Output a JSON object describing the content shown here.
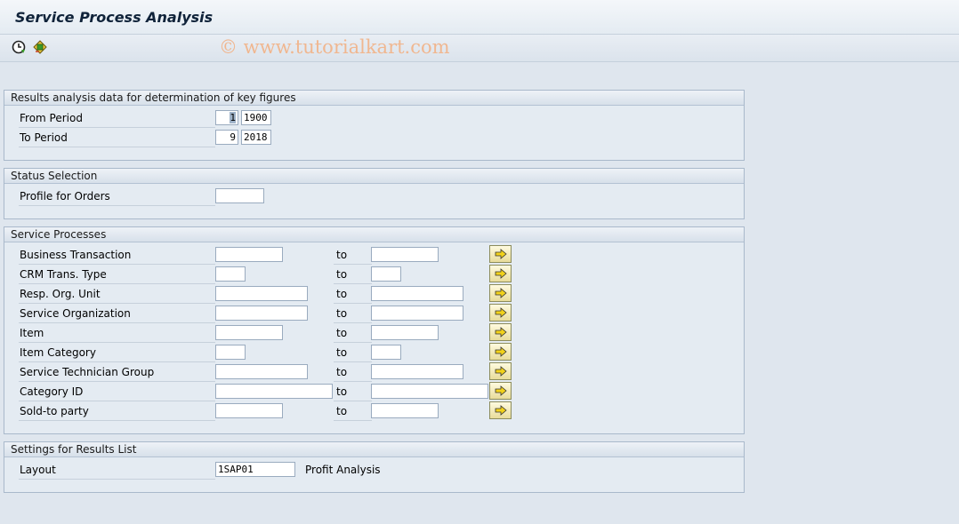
{
  "window": {
    "title": "Service Process Analysis"
  },
  "toolbar": {
    "execute_icon": "execute-clock-icon",
    "variant_icon": "get-variant-icon"
  },
  "watermark": "© www.tutorialkart.com",
  "results_group": {
    "title": "Results analysis data for determination of key figures",
    "from_label": "From Period",
    "from_period": "1",
    "from_year": "1900",
    "to_label": "To Period",
    "to_period": "9",
    "to_year": "2018"
  },
  "status_group": {
    "title": "Status Selection",
    "profile_label": "Profile for Orders",
    "profile_value": ""
  },
  "service_group": {
    "title": "Service Processes",
    "to_text": "to",
    "rows": [
      {
        "label": "Business Transaction",
        "from": "",
        "to": ""
      },
      {
        "label": "CRM Trans. Type",
        "from": "",
        "to": ""
      },
      {
        "label": "Resp. Org. Unit",
        "from": "",
        "to": ""
      },
      {
        "label": "Service Organization",
        "from": "",
        "to": ""
      },
      {
        "label": "Item",
        "from": "",
        "to": ""
      },
      {
        "label": "Item Category",
        "from": "",
        "to": ""
      },
      {
        "label": "Service Technician Group",
        "from": "",
        "to": ""
      },
      {
        "label": "Category ID",
        "from": "",
        "to": ""
      },
      {
        "label": "Sold-to party",
        "from": "",
        "to": ""
      }
    ]
  },
  "settings_group": {
    "title": "Settings for Results List",
    "layout_label": "Layout",
    "layout_value": "1SAP01",
    "layout_desc": "Profit Analysis"
  }
}
